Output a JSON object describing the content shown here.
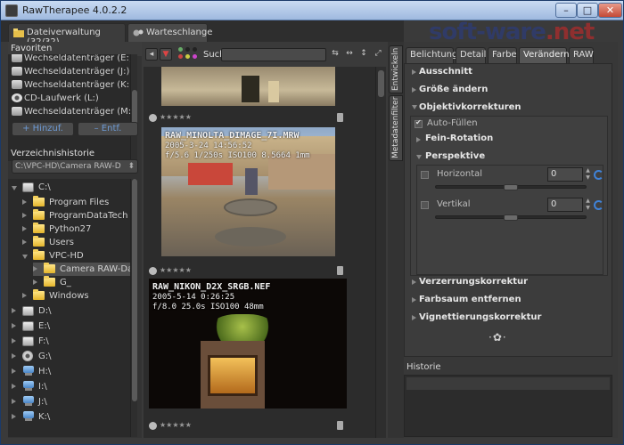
{
  "window": {
    "title": "RawTherapee 4.0.2.2",
    "minimize": "–",
    "maximize": "□",
    "close": "✕"
  },
  "top_tabs": [
    {
      "label": "Dateiverwaltung (32/32)"
    },
    {
      "label": "Warteschlange"
    }
  ],
  "favorites": {
    "header": "Favoriten",
    "items": [
      "Wechseldatenträger (E:)",
      "Wechseldatenträger (J:)",
      "Wechseldatenträger (K:)",
      "CD-Laufwerk (L:)",
      "Wechseldatenträger (M:)"
    ],
    "add_label": "+ Hinzuf.",
    "remove_label": "– Entf."
  },
  "history_dirs": {
    "header": "Verzeichnishistorie",
    "selected": "C:\\VPC-HD\\Camera RAW-D"
  },
  "tree": [
    {
      "label": "C:\\",
      "level": 0,
      "icon": "hdd-icon",
      "open": true
    },
    {
      "label": "Program Files",
      "level": 1,
      "icon": "folder-icon"
    },
    {
      "label": "ProgramDataTech",
      "level": 1,
      "icon": "folder-icon"
    },
    {
      "label": "Python27",
      "level": 1,
      "icon": "folder-icon"
    },
    {
      "label": "Users",
      "level": 1,
      "icon": "folder-icon"
    },
    {
      "label": "VPC-HD",
      "level": 1,
      "icon": "folder-icon",
      "open": true
    },
    {
      "label": "Camera RAW-Da",
      "level": 2,
      "icon": "folder-icon",
      "selected": true
    },
    {
      "label": "G_",
      "level": 2,
      "icon": "folder-icon"
    },
    {
      "label": "Windows",
      "level": 1,
      "icon": "folder-icon"
    },
    {
      "label": "D:\\",
      "level": 0,
      "icon": "hdd-icon"
    },
    {
      "label": "E:\\",
      "level": 0,
      "icon": "hdd-icon"
    },
    {
      "label": "F:\\",
      "level": 0,
      "icon": "hdd-icon"
    },
    {
      "label": "G:\\",
      "level": 0,
      "icon": "disc-icon"
    },
    {
      "label": "H:\\",
      "level": 0,
      "icon": "network-icon"
    },
    {
      "label": "I:\\",
      "level": 0,
      "icon": "network-icon"
    },
    {
      "label": "J:\\",
      "level": 0,
      "icon": "network-icon"
    },
    {
      "label": "K:\\",
      "level": 0,
      "icon": "network-icon"
    }
  ],
  "toolbar": {
    "search_label": "Suche:",
    "search_value": ""
  },
  "thumbnails": [
    {
      "name": "RAW_MINOLTA_DIMAGE_7I.MRW",
      "date": "2005-3-24 14:56:52",
      "exif": "f/5.6 1/250s ISO100 8.5664 1mm",
      "rating": "★★★★★"
    },
    {
      "name": "RAW_NIKON_D2X_SRGB.NEF",
      "date": "2005-5-14 0:26:25",
      "exif": "f/8.0 25.0s ISO100 48mm",
      "rating": "★★★★★"
    },
    {
      "rating": "★★★★★"
    },
    {
      "rating": "★★★★★"
    }
  ],
  "vertical_tabs": [
    "Entwickeln",
    "Metadatenfilter"
  ],
  "right_tabs": [
    "Belichtung",
    "Detail",
    "Farbe",
    "Verändern",
    "RAW"
  ],
  "tools": {
    "crop": "Ausschnitt",
    "resize": "Größe ändern",
    "lens": "Objektivkorrekturen",
    "autofill": "Auto-Füllen",
    "rotate": "Fein-Rotation",
    "perspective": "Perspektive",
    "horizontal_label": "Horizontal",
    "horizontal_value": "0",
    "vertical_label": "Vertikal",
    "vertical_value": "0",
    "distortion": "Verzerrungskorrektur",
    "fringe": "Farbsaum entfernen",
    "vignette": "Vignettierungskorrektur"
  },
  "history": {
    "header": "Historie"
  },
  "watermark": {
    "soft": "soft-ware",
    "net": ".net"
  }
}
